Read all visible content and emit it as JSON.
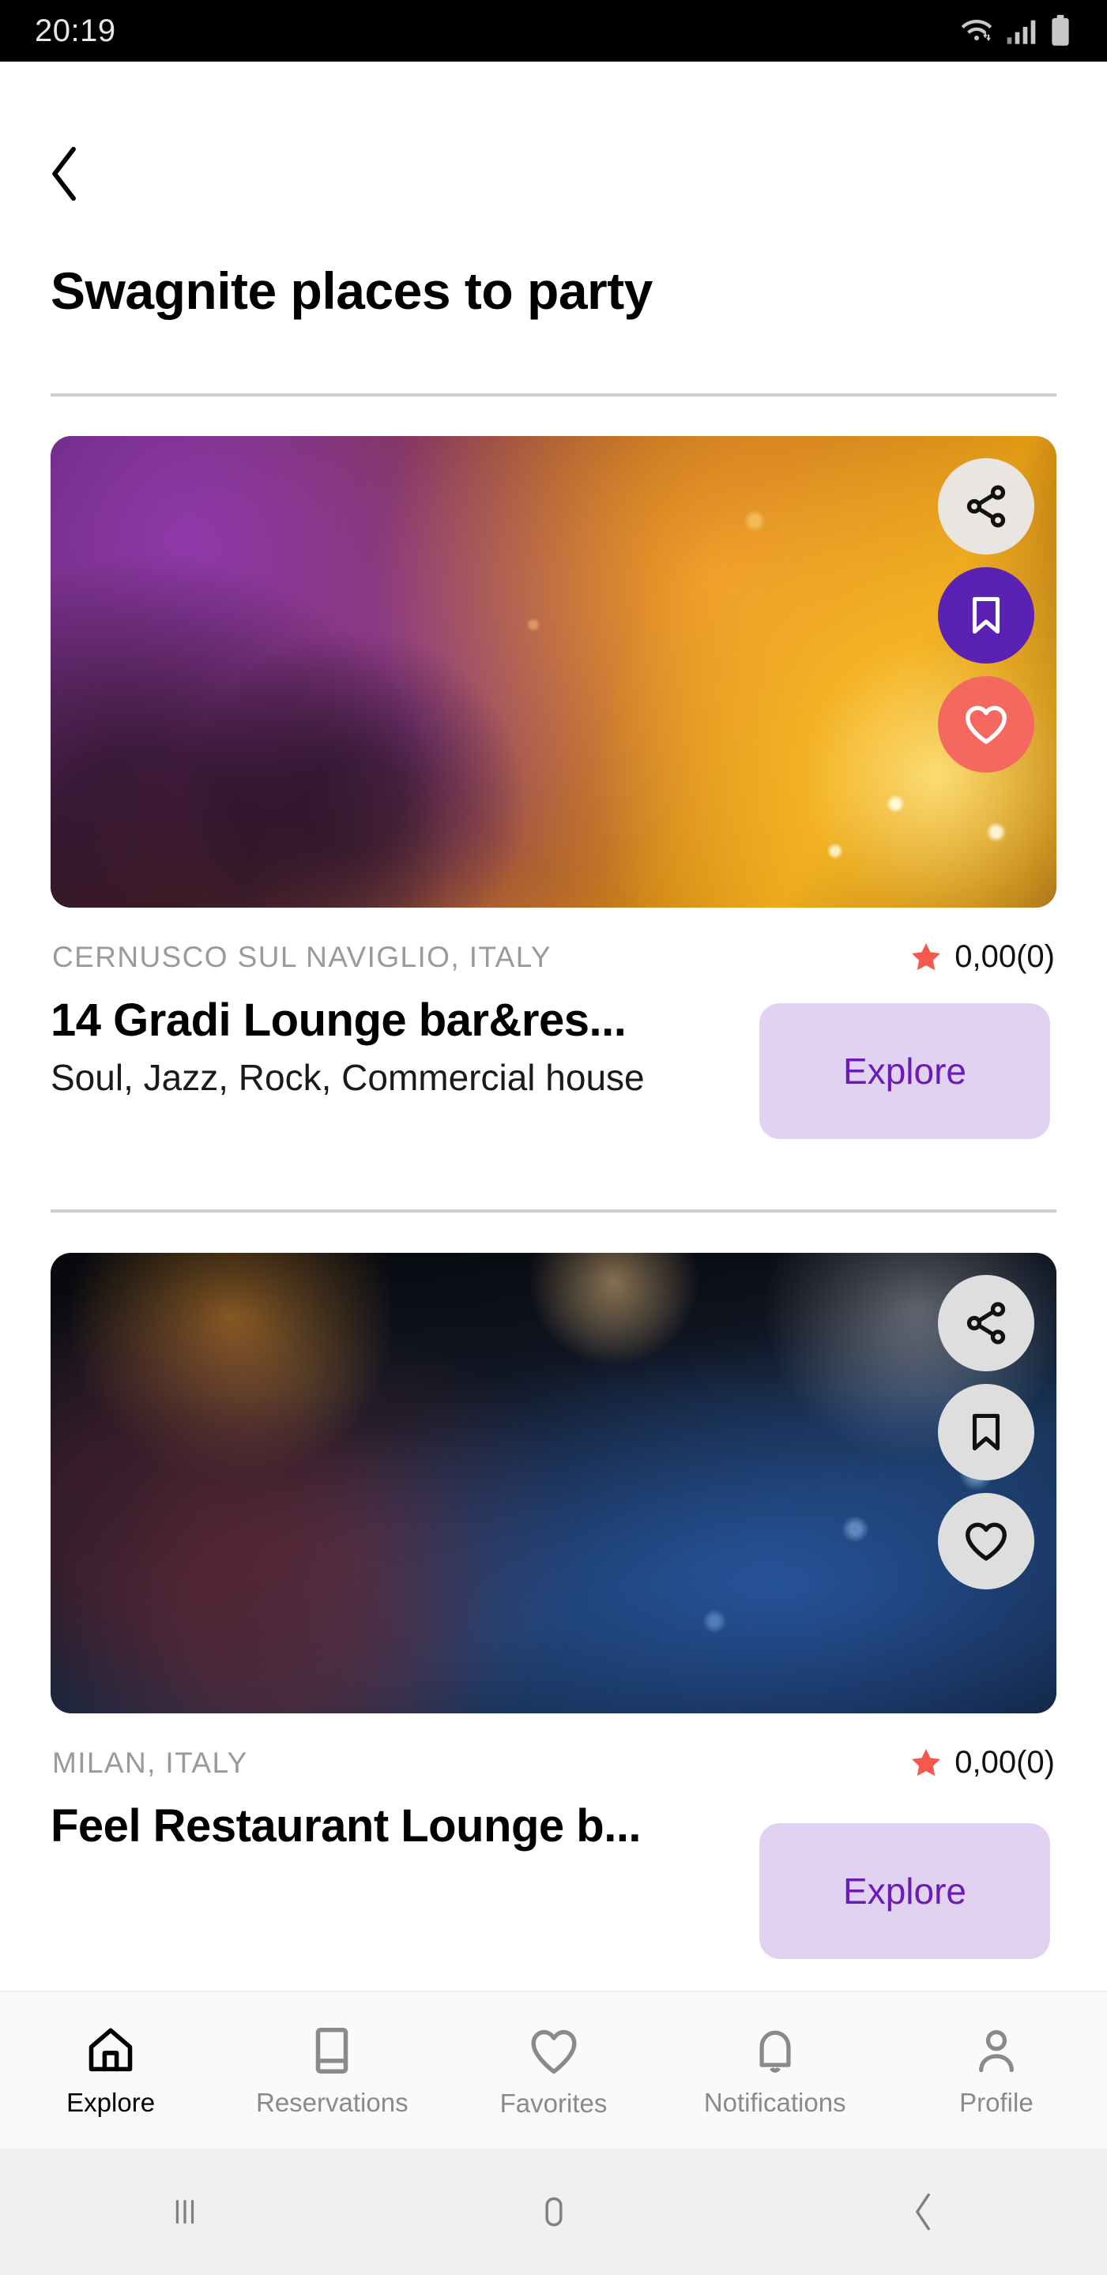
{
  "status_bar": {
    "time": "20:19",
    "icons": [
      "wifi-icon",
      "cellular-signal-icon",
      "battery-icon"
    ]
  },
  "header": {
    "back_icon": "chevron-left-icon",
    "title": "Swagnite places to party"
  },
  "colors": {
    "accent_purple": "#5a21b5",
    "explore_bg": "#e2d2f2",
    "explore_text": "#6a1bb8",
    "heart_coral": "#f5685f",
    "star_red": "#f5584d",
    "location_gray": "#9a9a9a"
  },
  "cards": [
    {
      "image_alt": "party-crowd-confetti-photo",
      "location": "CERNUSCO SUL NAVIGLIO, ITALY",
      "rating": "0,00(0)",
      "star_icon": "star-icon",
      "title": "14 Gradi Lounge bar&res...",
      "subtitle": "Soul, Jazz, Rock, Commercial house",
      "explore_label": "Explore",
      "actions": [
        {
          "icon": "share-icon",
          "state": "inactive"
        },
        {
          "icon": "bookmark-icon",
          "state": "active"
        },
        {
          "icon": "heart-icon",
          "state": "active"
        }
      ]
    },
    {
      "image_alt": "restaurant-table-blue-lighting-photo",
      "location": "MILAN, ITALY",
      "rating": "0,00(0)",
      "star_icon": "star-icon",
      "title": "Feel Restaurant Lounge b...",
      "subtitle": "",
      "explore_label": "Explore",
      "actions": [
        {
          "icon": "share-icon",
          "state": "inactive"
        },
        {
          "icon": "bookmark-icon",
          "state": "inactive"
        },
        {
          "icon": "heart-icon",
          "state": "inactive"
        }
      ]
    }
  ],
  "tabbar": {
    "active_index": 0,
    "items": [
      {
        "label": "Explore",
        "icon": "home-icon"
      },
      {
        "label": "Reservations",
        "icon": "book-icon"
      },
      {
        "label": "Favorites",
        "icon": "heart-icon"
      },
      {
        "label": "Notifications",
        "icon": "bell-icon"
      },
      {
        "label": "Profile",
        "icon": "person-icon"
      }
    ]
  },
  "android_nav": {
    "recents_icon": "recents-icon",
    "home_icon": "home-square-icon",
    "back_icon": "chevron-left-icon"
  }
}
